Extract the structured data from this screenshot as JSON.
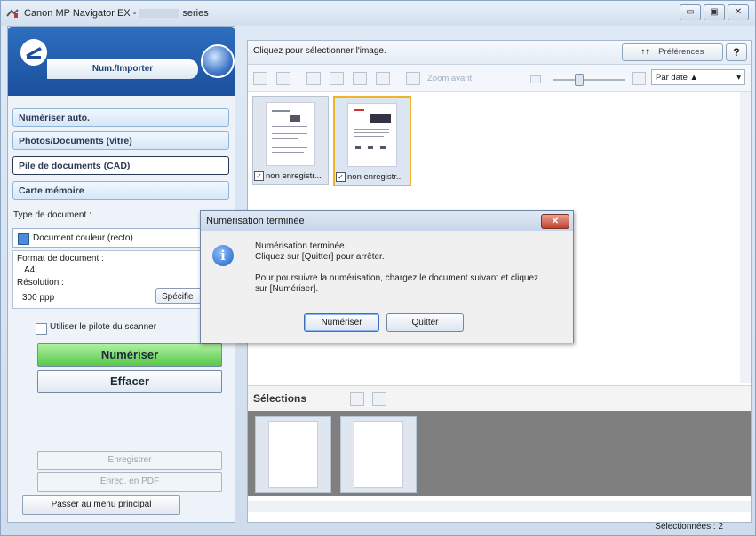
{
  "window": {
    "title_prefix": "Canon MP Navigator EX -",
    "title_suffix": "series",
    "minimize": "▭",
    "maximize": "▣",
    "close": "✕"
  },
  "left": {
    "header_tab": "Num./Importer",
    "nav": [
      "Numériser auto.",
      "Photos/Documents (vitre)",
      "Pile de documents (CAD)",
      "Carte mémoire"
    ],
    "active_nav_index": 2,
    "type_label": "Type de document :",
    "type_value": "Document couleur (recto)",
    "format_label": "Format de document :",
    "format_value": "A4",
    "resolution_label": "Résolution :",
    "resolution_value": "300 ppp",
    "spec_button": "Spécifie",
    "driver_checkbox": "Utiliser le pilote du scanner",
    "scan_button": "Numériser",
    "clear_button": "Effacer",
    "save_button": "Enregistrer",
    "save_pdf_button": "Enreg. en PDF",
    "main_menu_button": "Passer au menu principal"
  },
  "right": {
    "instruction": "Cliquez pour sélectionner l'image.",
    "preferences_button": "Préférences",
    "help_button": "?",
    "zoom_label": "Zoom avant",
    "sort_value": "Par date ▲",
    "thumbnails": [
      {
        "label": "non enregistr...",
        "checked": true,
        "selected": false
      },
      {
        "label": "non enregistr...",
        "checked": true,
        "selected": true
      }
    ],
    "selections_title": "Sélections",
    "status": "Sélectionnées : 2"
  },
  "dialog": {
    "title": "Numérisation terminée",
    "line1": "Numérisation terminée.",
    "line2": "Cliquez sur [Quitter] pour arrêter.",
    "line3": "Pour poursuivre la numérisation, chargez le document suivant et cliquez",
    "line4": "sur [Numériser].",
    "scan_button": "Numériser",
    "quit_button": "Quitter"
  },
  "colors": {
    "accent_blue": "#1a4f9c",
    "scan_green": "#58c84a",
    "selection_orange": "#f0b42c"
  }
}
